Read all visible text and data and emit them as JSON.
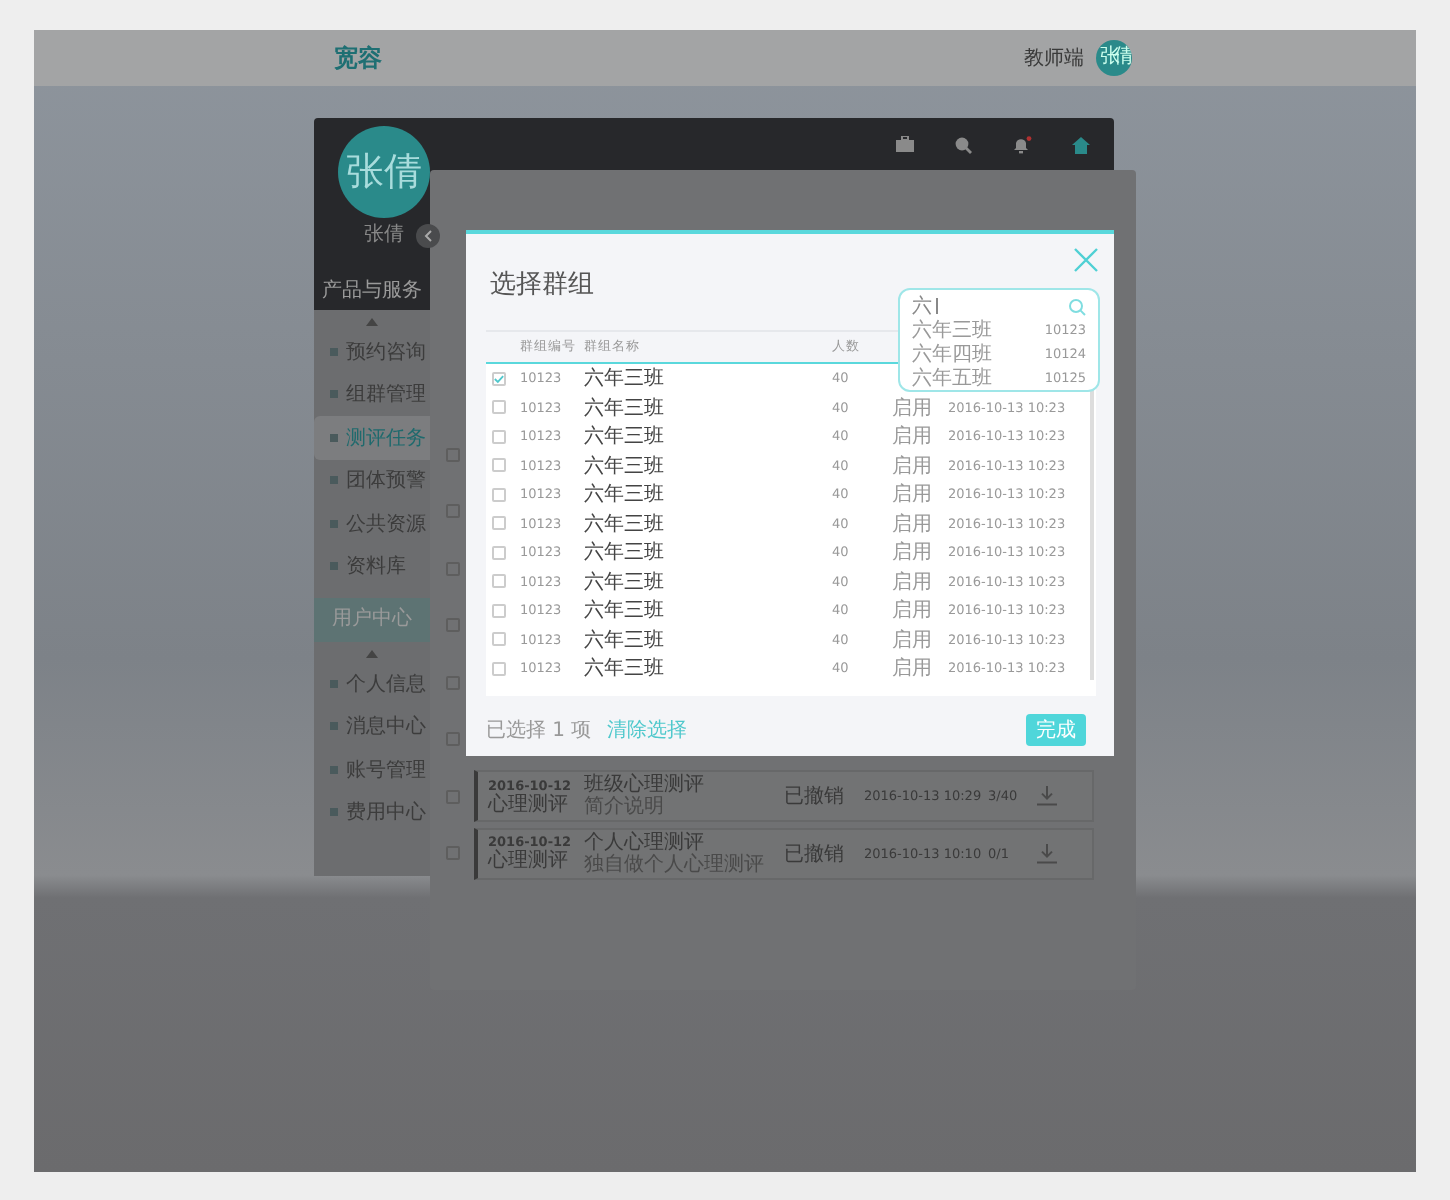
{
  "header": {
    "logo": "宽容",
    "role": "教师端",
    "avatar": "张倩"
  },
  "profile": {
    "avatar": "张倩",
    "name": "张倩"
  },
  "sidebar": {
    "sections": [
      {
        "title": "产品与服务",
        "kind": "dark",
        "items": [
          {
            "label": "预约咨询",
            "selected": false
          },
          {
            "label": "组群管理",
            "selected": false
          },
          {
            "label": "测评任务",
            "selected": true
          },
          {
            "label": "团体预警",
            "selected": false
          },
          {
            "label": "公共资源",
            "selected": false
          },
          {
            "label": "资料库",
            "selected": false
          }
        ]
      },
      {
        "title": "用户中心",
        "kind": "teal",
        "items": [
          {
            "label": "个人信息",
            "selected": false
          },
          {
            "label": "消息中心",
            "selected": false
          },
          {
            "label": "账号管理",
            "selected": false
          },
          {
            "label": "费用中心",
            "selected": false
          }
        ]
      }
    ]
  },
  "panel": {
    "hidden_checkboxes": [
      {
        "checked": false
      },
      {
        "checked": false
      },
      {
        "checked": false
      },
      {
        "checked": false
      },
      {
        "checked": false
      },
      {
        "checked": false
      }
    ],
    "tasks": [
      {
        "checked": false,
        "date": "2016-10-12",
        "type": "心理测评",
        "title": "班级心理测评",
        "description": "简介说明",
        "status": "已撤销",
        "time": "2016-10-13 10:29",
        "progress": "3/40"
      },
      {
        "checked": false,
        "date": "2016-10-12",
        "type": "心理测评",
        "title": "个人心理测评",
        "description": "独自做个人心理测评",
        "status": "已撤销",
        "time": "2016-10-13 10:10",
        "progress": "0/1"
      }
    ]
  },
  "dialog": {
    "title": "选择群组",
    "columns": [
      "群组编号",
      "群组名称",
      "人数"
    ],
    "rows": [
      {
        "id": "10123",
        "name": "六年三班",
        "count": "40",
        "selected": true
      },
      {
        "id": "10123",
        "name": "六年三班",
        "count": "40",
        "status": "启用",
        "date": "2016-10-13 10:23",
        "selected": false
      },
      {
        "id": "10123",
        "name": "六年三班",
        "count": "40",
        "status": "启用",
        "date": "2016-10-13 10:23",
        "selected": false
      },
      {
        "id": "10123",
        "name": "六年三班",
        "count": "40",
        "status": "启用",
        "date": "2016-10-13 10:23",
        "selected": false
      },
      {
        "id": "10123",
        "name": "六年三班",
        "count": "40",
        "status": "启用",
        "date": "2016-10-13 10:23",
        "selected": false
      },
      {
        "id": "10123",
        "name": "六年三班",
        "count": "40",
        "status": "启用",
        "date": "2016-10-13 10:23",
        "selected": false
      },
      {
        "id": "10123",
        "name": "六年三班",
        "count": "40",
        "status": "启用",
        "date": "2016-10-13 10:23",
        "selected": false
      },
      {
        "id": "10123",
        "name": "六年三班",
        "count": "40",
        "status": "启用",
        "date": "2016-10-13 10:23",
        "selected": false
      },
      {
        "id": "10123",
        "name": "六年三班",
        "count": "40",
        "status": "启用",
        "date": "2016-10-13 10:23",
        "selected": false
      },
      {
        "id": "10123",
        "name": "六年三班",
        "count": "40",
        "status": "启用",
        "date": "2016-10-13 10:23",
        "selected": false
      },
      {
        "id": "10123",
        "name": "六年三班",
        "count": "40",
        "status": "启用",
        "date": "2016-10-13 10:23",
        "selected": false
      }
    ],
    "search": {
      "value": "六",
      "suggestions": [
        {
          "name": "六年三班",
          "id": "10123"
        },
        {
          "name": "六年四班",
          "id": "10124"
        },
        {
          "name": "六年五班",
          "id": "10125"
        }
      ]
    },
    "selection_count": "已选择 1 项",
    "clear": "清除选择",
    "done": "完成"
  }
}
